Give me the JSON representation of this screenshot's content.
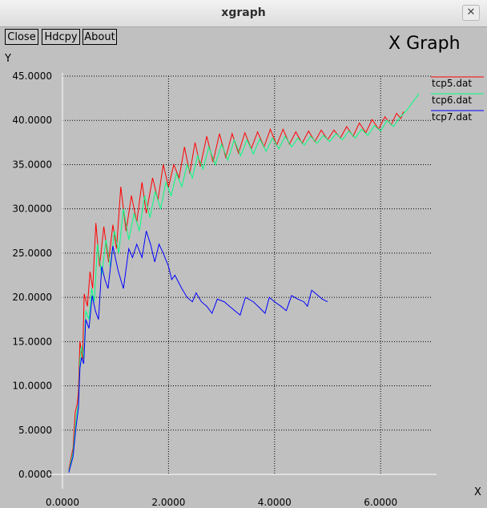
{
  "window": {
    "title": "xgraph",
    "close_glyph": "✕"
  },
  "toolbar": {
    "close_label": "Close",
    "hdcpy_label": "Hdcpy",
    "about_label": "About"
  },
  "graph_title": "X Graph",
  "chart_data": {
    "type": "line",
    "title": "X Graph",
    "xlabel": "X",
    "ylabel": "Y",
    "xlim": [
      0,
      7
    ],
    "ylim": [
      0,
      45
    ],
    "x_ticks": [
      "0.0000",
      "2.0000",
      "4.0000",
      "6.0000"
    ],
    "y_ticks": [
      "0.0000",
      "5.0000",
      "10.0000",
      "15.0000",
      "20.0000",
      "25.0000",
      "30.0000",
      "35.0000",
      "40.0000",
      "45.0000"
    ],
    "grid": true,
    "legend_position": "right",
    "series": [
      {
        "name": "tcp5.dat",
        "color": "#ff0000",
        "points": [
          [
            0.12,
            0.5
          ],
          [
            0.2,
            3.0
          ],
          [
            0.24,
            7.0
          ],
          [
            0.28,
            8.0
          ],
          [
            0.3,
            9.5
          ],
          [
            0.33,
            15.0
          ],
          [
            0.38,
            13.0
          ],
          [
            0.41,
            20.4
          ],
          [
            0.47,
            19.0
          ],
          [
            0.52,
            22.9
          ],
          [
            0.57,
            21.0
          ],
          [
            0.63,
            28.4
          ],
          [
            0.7,
            23.5
          ],
          [
            0.78,
            28.0
          ],
          [
            0.87,
            24.0
          ],
          [
            0.95,
            28.2
          ],
          [
            1.02,
            25.5
          ],
          [
            1.1,
            32.5
          ],
          [
            1.2,
            27.5
          ],
          [
            1.3,
            31.5
          ],
          [
            1.4,
            28.5
          ],
          [
            1.5,
            33.0
          ],
          [
            1.58,
            29.5
          ],
          [
            1.7,
            33.5
          ],
          [
            1.8,
            31.0
          ],
          [
            1.9,
            35.0
          ],
          [
            2.0,
            32.5
          ],
          [
            2.1,
            35.0
          ],
          [
            2.2,
            33.5
          ],
          [
            2.3,
            37.0
          ],
          [
            2.4,
            34.0
          ],
          [
            2.5,
            37.5
          ],
          [
            2.6,
            34.8
          ],
          [
            2.72,
            38.2
          ],
          [
            2.84,
            35.3
          ],
          [
            2.96,
            38.5
          ],
          [
            3.08,
            35.8
          ],
          [
            3.2,
            38.5
          ],
          [
            3.32,
            36.3
          ],
          [
            3.44,
            38.6
          ],
          [
            3.56,
            36.8
          ],
          [
            3.68,
            38.7
          ],
          [
            3.8,
            37.0
          ],
          [
            3.92,
            39.0
          ],
          [
            4.04,
            37.2
          ],
          [
            4.16,
            39.0
          ],
          [
            4.28,
            37.3
          ],
          [
            4.4,
            38.7
          ],
          [
            4.52,
            37.4
          ],
          [
            4.64,
            38.8
          ],
          [
            4.76,
            37.6
          ],
          [
            4.88,
            38.9
          ],
          [
            5.0,
            37.8
          ],
          [
            5.12,
            38.9
          ],
          [
            5.24,
            38.0
          ],
          [
            5.36,
            39.3
          ],
          [
            5.48,
            38.2
          ],
          [
            5.6,
            39.7
          ],
          [
            5.72,
            38.6
          ],
          [
            5.84,
            40.1
          ],
          [
            5.96,
            39.0
          ],
          [
            6.08,
            40.4
          ],
          [
            6.2,
            39.5
          ],
          [
            6.3,
            40.8
          ],
          [
            6.38,
            40.2
          ],
          [
            6.43,
            41.0
          ]
        ]
      },
      {
        "name": "tcp6.dat",
        "color": "#00ff80",
        "points": [
          [
            0.12,
            0.3
          ],
          [
            0.2,
            2.5
          ],
          [
            0.26,
            6.5
          ],
          [
            0.3,
            8.0
          ],
          [
            0.33,
            13.0
          ],
          [
            0.36,
            14.5
          ],
          [
            0.4,
            13.0
          ],
          [
            0.44,
            18.5
          ],
          [
            0.5,
            17.5
          ],
          [
            0.55,
            21.0
          ],
          [
            0.6,
            19.5
          ],
          [
            0.66,
            26.0
          ],
          [
            0.74,
            22.5
          ],
          [
            0.82,
            26.5
          ],
          [
            0.9,
            23.5
          ],
          [
            0.98,
            27.5
          ],
          [
            1.06,
            25.0
          ],
          [
            1.15,
            30.0
          ],
          [
            1.25,
            26.5
          ],
          [
            1.35,
            29.5
          ],
          [
            1.45,
            27.5
          ],
          [
            1.55,
            31.5
          ],
          [
            1.65,
            29.0
          ],
          [
            1.75,
            32.0
          ],
          [
            1.85,
            30.0
          ],
          [
            1.95,
            33.0
          ],
          [
            2.05,
            31.5
          ],
          [
            2.15,
            34.0
          ],
          [
            2.25,
            32.5
          ],
          [
            2.35,
            35.0
          ],
          [
            2.45,
            33.5
          ],
          [
            2.55,
            36.0
          ],
          [
            2.65,
            34.5
          ],
          [
            2.76,
            37.0
          ],
          [
            2.88,
            35.0
          ],
          [
            3.0,
            37.3
          ],
          [
            3.12,
            35.5
          ],
          [
            3.24,
            37.8
          ],
          [
            3.36,
            36.0
          ],
          [
            3.48,
            37.8
          ],
          [
            3.6,
            36.2
          ],
          [
            3.72,
            37.9
          ],
          [
            3.84,
            36.5
          ],
          [
            3.96,
            38.0
          ],
          [
            4.08,
            36.8
          ],
          [
            4.2,
            38.2
          ],
          [
            4.32,
            37.0
          ],
          [
            4.44,
            38.0
          ],
          [
            4.56,
            37.2
          ],
          [
            4.68,
            38.2
          ],
          [
            4.8,
            37.4
          ],
          [
            4.92,
            38.3
          ],
          [
            5.04,
            37.6
          ],
          [
            5.16,
            38.5
          ],
          [
            5.28,
            37.8
          ],
          [
            5.4,
            38.8
          ],
          [
            5.52,
            38.0
          ],
          [
            5.64,
            39.0
          ],
          [
            5.76,
            38.3
          ],
          [
            5.88,
            39.4
          ],
          [
            6.0,
            38.8
          ],
          [
            6.12,
            40.0
          ],
          [
            6.24,
            39.3
          ],
          [
            6.36,
            40.3
          ],
          [
            6.5,
            41.2
          ],
          [
            6.6,
            42.0
          ],
          [
            6.72,
            43.0
          ]
        ]
      },
      {
        "name": "tcp7.dat",
        "color": "#0000ff",
        "points": [
          [
            0.12,
            0.2
          ],
          [
            0.2,
            2.0
          ],
          [
            0.25,
            5.0
          ],
          [
            0.3,
            7.5
          ],
          [
            0.33,
            12.0
          ],
          [
            0.36,
            13.2
          ],
          [
            0.4,
            12.5
          ],
          [
            0.44,
            17.5
          ],
          [
            0.5,
            16.5
          ],
          [
            0.56,
            20.2
          ],
          [
            0.62,
            18.5
          ],
          [
            0.68,
            17.5
          ],
          [
            0.74,
            23.5
          ],
          [
            0.8,
            22.0
          ],
          [
            0.86,
            21.0
          ],
          [
            0.95,
            25.8
          ],
          [
            1.05,
            23.0
          ],
          [
            1.15,
            21.0
          ],
          [
            1.25,
            25.5
          ],
          [
            1.32,
            24.5
          ],
          [
            1.4,
            26.0
          ],
          [
            1.5,
            24.5
          ],
          [
            1.58,
            27.5
          ],
          [
            1.66,
            26.0
          ],
          [
            1.74,
            24.0
          ],
          [
            1.82,
            26.0
          ],
          [
            1.9,
            25.0
          ],
          [
            2.0,
            23.5
          ],
          [
            2.06,
            22.0
          ],
          [
            2.12,
            22.5
          ],
          [
            2.25,
            21.0
          ],
          [
            2.35,
            20.0
          ],
          [
            2.45,
            19.5
          ],
          [
            2.52,
            20.5
          ],
          [
            2.62,
            19.5
          ],
          [
            2.72,
            19.0
          ],
          [
            2.82,
            18.2
          ],
          [
            2.92,
            19.8
          ],
          [
            3.05,
            19.5
          ],
          [
            3.15,
            19.0
          ],
          [
            3.25,
            18.5
          ],
          [
            3.35,
            18.0
          ],
          [
            3.45,
            20.0
          ],
          [
            3.6,
            19.5
          ],
          [
            3.72,
            18.8
          ],
          [
            3.82,
            18.2
          ],
          [
            3.9,
            20.0
          ],
          [
            4.0,
            19.5
          ],
          [
            4.12,
            19.0
          ],
          [
            4.22,
            18.5
          ],
          [
            4.32,
            20.2
          ],
          [
            4.44,
            19.8
          ],
          [
            4.55,
            19.5
          ],
          [
            4.62,
            19.0
          ],
          [
            4.7,
            20.8
          ],
          [
            4.8,
            20.3
          ],
          [
            4.9,
            19.8
          ],
          [
            5.0,
            19.5
          ]
        ]
      }
    ]
  }
}
